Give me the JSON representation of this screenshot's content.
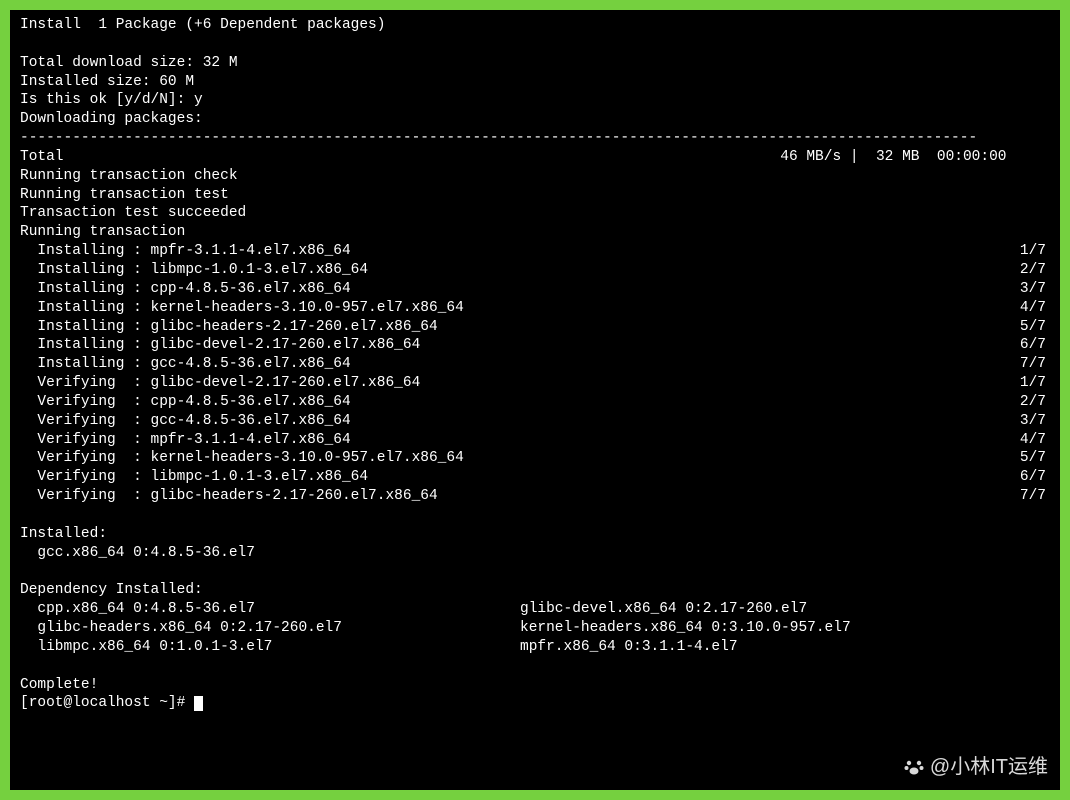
{
  "summary": {
    "install_line": "Install  1 Package (+6 Dependent packages)",
    "download_size": "Total download size: 32 M",
    "installed_size": "Installed size: 60 M",
    "confirm_prompt": "Is this ok [y/d/N]: y",
    "downloading": "Downloading packages:"
  },
  "divider": "--------------------------------------------------------------------------------------------------------------",
  "total": {
    "label": "Total",
    "speed_info": "46 MB/s |  32 MB  00:00:00     "
  },
  "transaction": {
    "check": "Running transaction check",
    "test": "Running transaction test",
    "succeeded": "Transaction test succeeded",
    "running": "Running transaction"
  },
  "actions": [
    {
      "action": "  Installing : mpfr-3.1.1-4.el7.x86_64",
      "count": "1/7"
    },
    {
      "action": "  Installing : libmpc-1.0.1-3.el7.x86_64",
      "count": "2/7"
    },
    {
      "action": "  Installing : cpp-4.8.5-36.el7.x86_64",
      "count": "3/7"
    },
    {
      "action": "  Installing : kernel-headers-3.10.0-957.el7.x86_64",
      "count": "4/7"
    },
    {
      "action": "  Installing : glibc-headers-2.17-260.el7.x86_64",
      "count": "5/7"
    },
    {
      "action": "  Installing : glibc-devel-2.17-260.el7.x86_64",
      "count": "6/7"
    },
    {
      "action": "  Installing : gcc-4.8.5-36.el7.x86_64",
      "count": "7/7"
    },
    {
      "action": "  Verifying  : glibc-devel-2.17-260.el7.x86_64",
      "count": "1/7"
    },
    {
      "action": "  Verifying  : cpp-4.8.5-36.el7.x86_64",
      "count": "2/7"
    },
    {
      "action": "  Verifying  : gcc-4.8.5-36.el7.x86_64",
      "count": "3/7"
    },
    {
      "action": "  Verifying  : mpfr-3.1.1-4.el7.x86_64",
      "count": "4/7"
    },
    {
      "action": "  Verifying  : kernel-headers-3.10.0-957.el7.x86_64",
      "count": "5/7"
    },
    {
      "action": "  Verifying  : libmpc-1.0.1-3.el7.x86_64",
      "count": "6/7"
    },
    {
      "action": "  Verifying  : glibc-headers-2.17-260.el7.x86_64",
      "count": "7/7"
    }
  ],
  "installed_section": {
    "header": "Installed:",
    "items": [
      "  gcc.x86_64 0:4.8.5-36.el7"
    ]
  },
  "dependency_section": {
    "header": "Dependency Installed:",
    "rows": [
      [
        "  cpp.x86_64 0:4.8.5-36.el7",
        "glibc-devel.x86_64 0:2.17-260.el7"
      ],
      [
        "  glibc-headers.x86_64 0:2.17-260.el7",
        "kernel-headers.x86_64 0:3.10.0-957.el7"
      ],
      [
        "  libmpc.x86_64 0:1.0.1-3.el7",
        "mpfr.x86_64 0:3.1.1-4.el7"
      ]
    ]
  },
  "complete": "Complete!",
  "prompt": "[root@localhost ~]# ",
  "watermark": "@小林IT运维"
}
